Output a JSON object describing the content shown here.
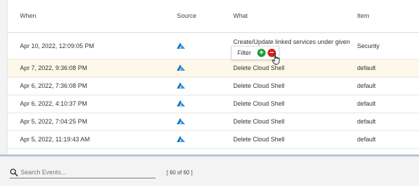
{
  "table": {
    "columns": [
      "When",
      "Source",
      "What",
      "Item"
    ],
    "rows": [
      {
        "when": "Apr 10, 2022, 12:09:05 PM",
        "source_icon": "azure-icon",
        "what": "Create/Update linked services under given",
        "item": "Security"
      },
      {
        "when": "Apr 7, 2022, 9:36:08 PM",
        "source_icon": "azure-icon",
        "what": "Delete Cloud Shell",
        "item": "default"
      },
      {
        "when": "Apr 6, 2022, 7:36:08 PM",
        "source_icon": "azure-icon",
        "what": "Delete Cloud Shell",
        "item": "default"
      },
      {
        "when": "Apr 6, 2022, 4:10:37 PM",
        "source_icon": "azure-icon",
        "what": "Delete Cloud Shell",
        "item": "default"
      },
      {
        "when": "Apr 5, 2022, 7:04:25 PM",
        "source_icon": "azure-icon",
        "what": "Delete Cloud Shell",
        "item": "default"
      },
      {
        "when": "Apr 5, 2022, 11:19:43 AM",
        "source_icon": "azure-icon",
        "what": "Delete Cloud Shell",
        "item": "default"
      }
    ]
  },
  "filter_popup": {
    "label": "Filter",
    "add_icon": "plus-circle-icon",
    "remove_icon": "minus-circle-icon",
    "add_color": "#1f9d3a",
    "remove_color": "#d91c1c"
  },
  "footer": {
    "search_placeholder": "Search Events...",
    "search_value": "",
    "count": "[ 60 of 60 ]"
  },
  "colors": {
    "hover_row": "#fdf8ea",
    "azure_blue": "#0a6fbf",
    "divider": "#b9c4d0"
  }
}
